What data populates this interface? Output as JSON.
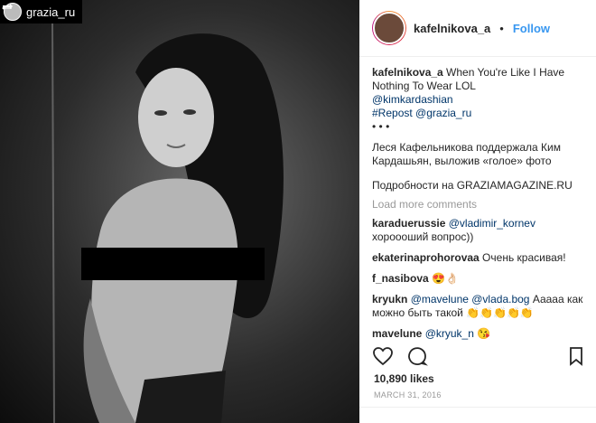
{
  "repost_tag": {
    "handle": "grazia_ru"
  },
  "header": {
    "username": "kafelnikova_a",
    "dot": "•",
    "follow": "Follow"
  },
  "caption": {
    "username": "kafelnikova_a",
    "line1": " When You're Like I Have Nothing To Wear LOL",
    "mention": "@kimkardashian",
    "hashtag": "#Repost",
    "mention2": "@grazia_ru",
    "dots": "• • •",
    "body": "Леся Кафельникова поддержала Ким Кардашьян, выложив «голое» фото",
    "source": "Подробности на GRAZIAMAGAZINE.RU"
  },
  "load_more": "Load more comments",
  "comments": [
    {
      "user": "karaduerussie",
      "mention": "@vladimir_kornev",
      "text": " хороооший вопрос))"
    },
    {
      "user": "ekaterinaprohorovaa",
      "mention": "",
      "text": " Очень красивая!"
    },
    {
      "user": "f_nasibova",
      "mention": "",
      "text": " 😍👌🏻"
    },
    {
      "user": "kryukn",
      "mention": "@mavelune @vlada.bog",
      "text": " Аааaa как можно быть такой 👏👏👏👏👏"
    },
    {
      "user": "mavelune",
      "mention": "@kryuk_n",
      "text": " 😘"
    }
  ],
  "likes": "10,890 likes",
  "date": "MARCH 31, 2016",
  "icons": {
    "like": "heart-icon",
    "comment": "comment-icon",
    "save": "bookmark-icon",
    "repost": "repost-icon"
  }
}
